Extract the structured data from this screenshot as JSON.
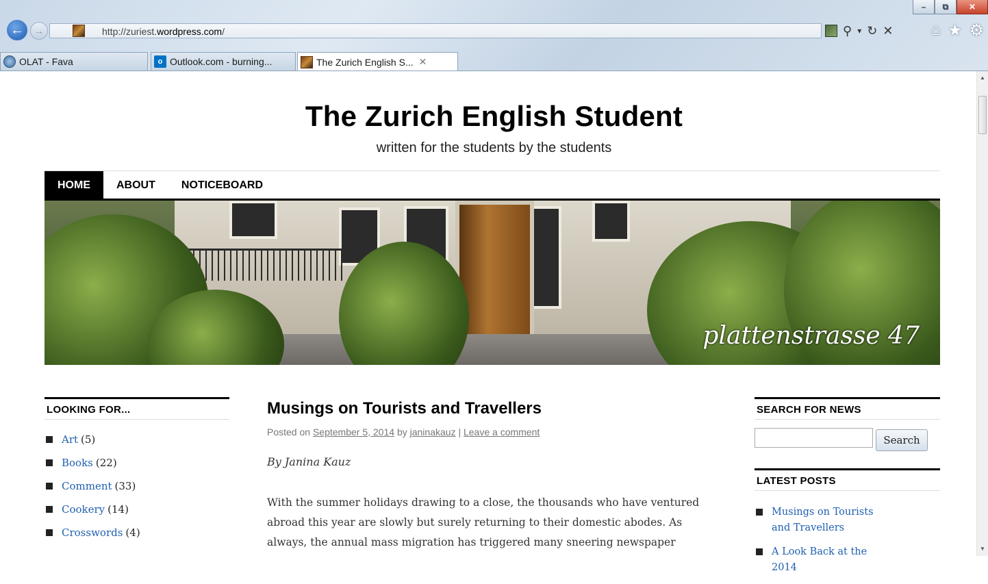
{
  "browser": {
    "address_host": "http://zuriest.",
    "address_domain": "wordpress.com",
    "address_path": "/",
    "window_controls": {
      "minimize": "–",
      "maximize": "⧉",
      "close": "✕"
    },
    "tools": {
      "search": "⚲",
      "dropdown": "▾",
      "refresh": "↻",
      "stop": "✕"
    },
    "toolbar": {
      "home": "⌂",
      "favorites": "★",
      "settings": "⚙"
    },
    "tabs": [
      {
        "label": "OLAT - Fava",
        "icon": "olat-icon"
      },
      {
        "label": "Outlook.com - burning...",
        "icon": "outlook-icon"
      },
      {
        "label": "The Zurich English S...",
        "icon": "site-favicon",
        "active": true,
        "close": "✕"
      }
    ]
  },
  "site": {
    "title": "The Zurich English Student",
    "description": "written for the students by the students",
    "menu": [
      {
        "label": "HOME",
        "current": true
      },
      {
        "label": "ABOUT"
      },
      {
        "label": "NOTICEBOARD"
      }
    ],
    "header_caption": "plattenstrasse 47"
  },
  "sidebar_left": {
    "title": "LOOKING FOR...",
    "categories": [
      {
        "name": "Art",
        "count": "(5)"
      },
      {
        "name": "Books",
        "count": "(22)"
      },
      {
        "name": "Comment",
        "count": "(33)"
      },
      {
        "name": "Cookery",
        "count": "(14)"
      },
      {
        "name": "Crosswords",
        "count": "(4)"
      }
    ]
  },
  "post": {
    "title": "Musings on Tourists and Travellers",
    "posted_on": "Posted on",
    "date": "September 5, 2014",
    "by": "by",
    "author": "janinakauz",
    "separator": "|",
    "comment_link": "Leave a comment",
    "byline": "By Janina Kauz",
    "body_lines": [
      "With the summer holidays drawing to a close, the thousands who have ventured",
      "abroad this year are slowly but surely returning to their domestic abodes. As",
      "always, the annual mass migration has triggered many sneering newspaper"
    ]
  },
  "sidebar_right": {
    "search_title": "SEARCH FOR NEWS",
    "search_button": "Search",
    "latest_title": "LATEST POSTS",
    "latest_posts": [
      "Musings on Tourists and Travellers",
      "A Look Back at the 2014"
    ]
  }
}
